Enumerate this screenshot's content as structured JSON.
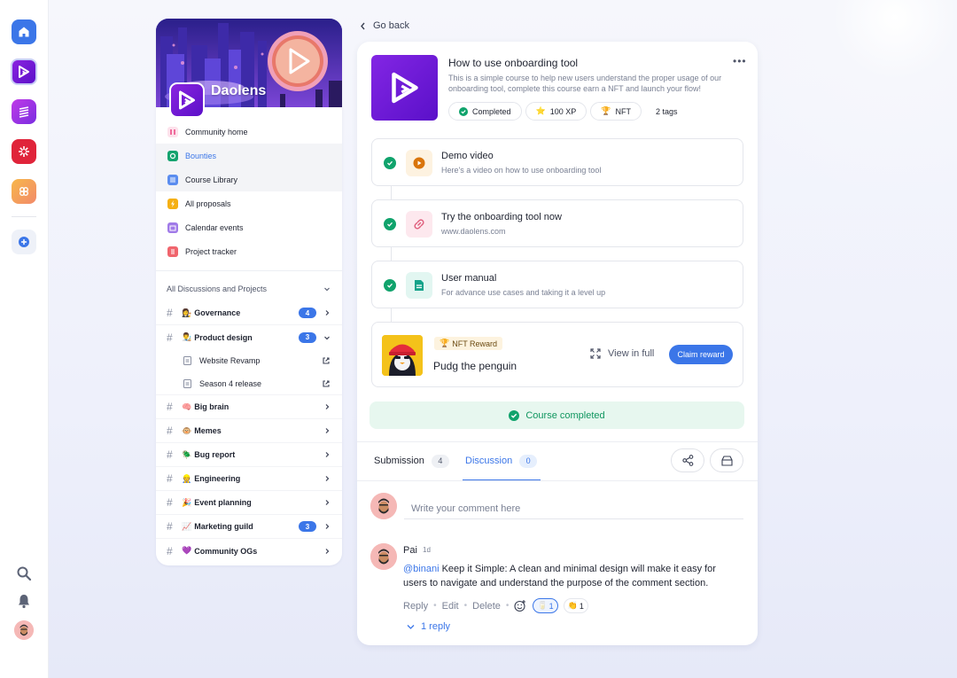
{
  "community": {
    "name": "Daolens",
    "menu": [
      {
        "label": "Community home",
        "color": "#f06a9b"
      },
      {
        "label": "Bounties",
        "color": "#14a36e"
      },
      {
        "label": "Course Library",
        "color": "#5b8def"
      },
      {
        "label": "All proposals",
        "color": "#f5b014"
      },
      {
        "label": "Calendar events",
        "color": "#a07ae8"
      },
      {
        "label": "Project tracker",
        "color": "#f0656d"
      }
    ],
    "section_title": "All Discussions and Projects",
    "channels": [
      {
        "emoji": "👩‍⚖️",
        "name": "Governance",
        "badge": "4"
      },
      {
        "emoji": "👨‍🎨",
        "name": "Product design",
        "badge": "3"
      },
      {
        "emoji": "🧠",
        "name": "Big brain"
      },
      {
        "emoji": "🐵",
        "name": "Memes"
      },
      {
        "emoji": "🪲",
        "name": "Bug report"
      },
      {
        "emoji": "👷",
        "name": "Engineering"
      },
      {
        "emoji": "🎉",
        "name": "Event planning"
      },
      {
        "emoji": "📈",
        "name": "Marketing guild",
        "badge": "3"
      },
      {
        "emoji": "💜",
        "name": "Community OGs"
      }
    ],
    "subpages": [
      {
        "name": "Website Revamp"
      },
      {
        "name": "Season 4 release"
      }
    ]
  },
  "nav": {
    "go_back": "Go back"
  },
  "course": {
    "title": "How to use onboarding tool",
    "description": "This is a simple course to help new users understand the proper usage of our onboarding tool, complete this course earn a NFT and launch your flow!",
    "tags": {
      "status": "Completed",
      "xp": "100 XP",
      "nft": "NFT",
      "more": "2 tags"
    },
    "steps": [
      {
        "title": "Demo video",
        "subtitle": "Here's a video on how to use onboarding tool",
        "icon": "play-icon"
      },
      {
        "title": "Try the onboarding tool now",
        "subtitle": "www.daolens.com",
        "icon": "link-icon"
      },
      {
        "title": "User manual",
        "subtitle": "For advance use cases and taking it a level up",
        "icon": "document-icon"
      }
    ],
    "reward": {
      "label": "NFT Reward",
      "name": "Pudg the penguin",
      "view_full": "View in full",
      "claim": "Claim reward"
    },
    "completed": "Course completed"
  },
  "tabs": {
    "submission": {
      "label": "Submission",
      "count": "4"
    },
    "discussion": {
      "label": "Discussion",
      "count": "0"
    }
  },
  "comment_box": {
    "placeholder": "Write your comment here"
  },
  "comment": {
    "author": "Pai",
    "time": "1d",
    "mention": "@binani",
    "text": " Keep it Simple: A clean and minimal design will make it easy for users to navigate and understand the purpose of the comment section.",
    "reply": "Reply",
    "edit": "Edit",
    "delete": "Delete",
    "reactions": [
      {
        "emoji": "🥛",
        "count": "1"
      },
      {
        "emoji": "👏",
        "count": "1"
      }
    ],
    "replies": "1 reply"
  },
  "colors": {
    "accent": "#3b76e8",
    "success": "#10a36c",
    "brand": "#7a1fe0"
  }
}
